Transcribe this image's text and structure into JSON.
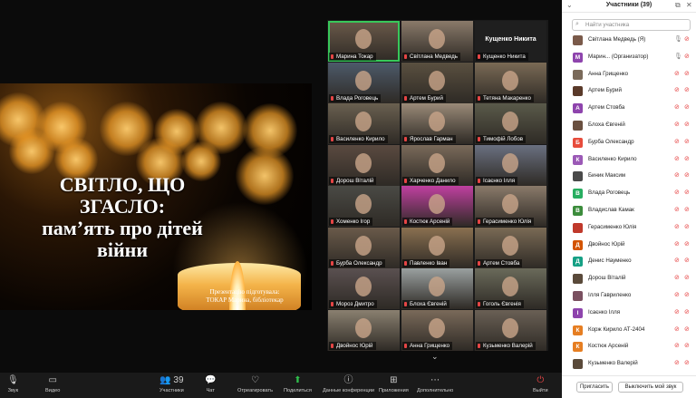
{
  "share": {
    "title_lines": [
      "СВІТЛО, ЩО",
      "ЗГАСЛО:",
      "пам’ять про дітей",
      "війни"
    ],
    "credit_lines": [
      "Презентацію підготувала:",
      "ТОКАР Марина, бібліотекар"
    ]
  },
  "gallery": {
    "tiles": [
      {
        "label": "Марина Токар",
        "active": true
      },
      {
        "label": "Світлана Медведь"
      },
      {
        "label": "Кущенко Никита",
        "nocam": true,
        "big": "Кущенко Никита"
      },
      {
        "label": "Влада Роговець"
      },
      {
        "label": "Артем Бурий"
      },
      {
        "label": "Тетяна Макаренко"
      },
      {
        "label": "Василенко Кирило"
      },
      {
        "label": "Ярослав Гарман"
      },
      {
        "label": "Тимофій Лобов"
      },
      {
        "label": "Дорош Віталій"
      },
      {
        "label": "Харченко Данило"
      },
      {
        "label": "Ісаєнко Ілля"
      },
      {
        "label": "Хоменко Ігор"
      },
      {
        "label": "Костюк Арсеній"
      },
      {
        "label": "Герасименко Юлія"
      },
      {
        "label": "Бурба Олександр"
      },
      {
        "label": "Павленко Іван"
      },
      {
        "label": "Артем Стовба"
      },
      {
        "label": "Мороз Дмитро"
      },
      {
        "label": "Блоха Євгеній"
      },
      {
        "label": "Гоголь Євгенія"
      },
      {
        "label": "Двойнос Юрій"
      },
      {
        "label": "Анна Грищенко"
      },
      {
        "label": "Кузьменко Валерій"
      }
    ]
  },
  "panel": {
    "title": "Участники (39)",
    "search_placeholder": "Найти участника",
    "participants": [
      {
        "name": "Світлана Медведь (Я)",
        "color": "#7a5a4a",
        "initial": "",
        "mic_on": true
      },
      {
        "name": "Марин... (Организатор)",
        "color": "#8e44ad",
        "initial": "М",
        "mic_on": true
      },
      {
        "name": "Анна Грищенко",
        "color": "#7a6a5a",
        "initial": ""
      },
      {
        "name": "Артем Бурий",
        "color": "#5a3a2a",
        "initial": ""
      },
      {
        "name": "Артем Стовба",
        "color": "#8e44ad",
        "initial": "А"
      },
      {
        "name": "Блоха Євгеній",
        "color": "#6a5040",
        "initial": ""
      },
      {
        "name": "Бурба Олександр",
        "color": "#e74c3c",
        "initial": "Б"
      },
      {
        "name": "Василенко Кирило",
        "color": "#9b59b6",
        "initial": "К"
      },
      {
        "name": "Биник Максим",
        "color": "#4a4a4a",
        "initial": ""
      },
      {
        "name": "Влада Роговець",
        "color": "#27ae60",
        "initial": "В"
      },
      {
        "name": "Владислав Камак",
        "color": "#3c8c3c",
        "initial": "В"
      },
      {
        "name": "Герасименко Юлія",
        "color": "#c0392b",
        "initial": ""
      },
      {
        "name": "Двойнос Юрій",
        "color": "#d35400",
        "initial": "Д"
      },
      {
        "name": "Денис Науменко",
        "color": "#16a085",
        "initial": "Д"
      },
      {
        "name": "Дорош Віталій",
        "color": "#5a4a3a",
        "initial": ""
      },
      {
        "name": "Ілля Гавриленко",
        "color": "#7a5060",
        "initial": ""
      },
      {
        "name": "Ісаєнко Ілля",
        "color": "#8e44ad",
        "initial": "І"
      },
      {
        "name": "Корж Кирило АТ-2404",
        "color": "#e67e22",
        "initial": "К"
      },
      {
        "name": "Костюк Арсеній",
        "color": "#e67e22",
        "initial": "К"
      },
      {
        "name": "Кузьменко Валерій",
        "color": "#5a4a3a",
        "initial": ""
      }
    ],
    "invite_label": "Пригласить",
    "mute_all_label": "Выключить мой звук"
  },
  "toolbar": {
    "items": [
      {
        "label": "Звук",
        "icon": "🎙"
      },
      {
        "label": "Видео",
        "icon": "▭"
      },
      {
        "label": "Участники",
        "icon": "👥",
        "count": "39"
      },
      {
        "label": "Чат",
        "icon": "💬"
      },
      {
        "label": "Отреагировать",
        "icon": "♡"
      },
      {
        "label": "Поделиться",
        "icon": "⬆"
      },
      {
        "label": "Данные конференции",
        "icon": "ⓘ"
      },
      {
        "label": "Приложения",
        "icon": "⊞"
      },
      {
        "label": "Дополнительно",
        "icon": "⋯"
      },
      {
        "label": "Выйти",
        "icon": "⏻"
      }
    ]
  }
}
